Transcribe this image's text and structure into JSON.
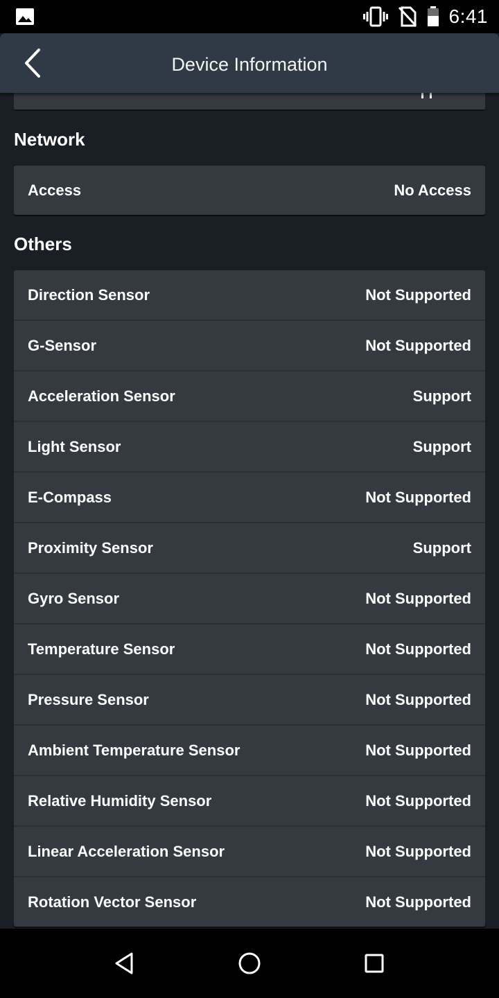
{
  "status_bar": {
    "time": "6:41",
    "icons": [
      "image-icon",
      "vibrate-icon",
      "no-sim-icon",
      "battery-icon"
    ]
  },
  "app_bar": {
    "title": "Device Information",
    "back_icon": "chevron-left-icon"
  },
  "sections": {
    "network": {
      "title": "Network",
      "rows": [
        {
          "label": "Access",
          "value": "No Access"
        }
      ]
    },
    "others": {
      "title": "Others",
      "rows": [
        {
          "label": "Direction Sensor",
          "value": "Not Supported"
        },
        {
          "label": "G-Sensor",
          "value": "Not Supported"
        },
        {
          "label": "Acceleration Sensor",
          "value": "Support"
        },
        {
          "label": "Light Sensor",
          "value": "Support"
        },
        {
          "label": "E-Compass",
          "value": "Not Supported"
        },
        {
          "label": "Proximity Sensor",
          "value": "Support"
        },
        {
          "label": "Gyro Sensor",
          "value": "Not Supported"
        },
        {
          "label": "Temperature Sensor",
          "value": "Not Supported"
        },
        {
          "label": "Pressure Sensor",
          "value": "Not Supported"
        },
        {
          "label": "Ambient Temperature Sensor",
          "value": "Not Supported"
        },
        {
          "label": "Relative Humidity Sensor",
          "value": "Not Supported"
        },
        {
          "label": "Linear Acceleration Sensor",
          "value": "Not Supported"
        },
        {
          "label": "Rotation Vector Sensor",
          "value": "Not Supported"
        }
      ]
    }
  },
  "nav_bar": {
    "icons": [
      "back-triangle-icon",
      "home-circle-icon",
      "recents-square-icon"
    ]
  },
  "colors": {
    "background": "#1a1f25",
    "app_bar": "#2f3a46",
    "card": "#343a40",
    "text": "#ffffff"
  }
}
